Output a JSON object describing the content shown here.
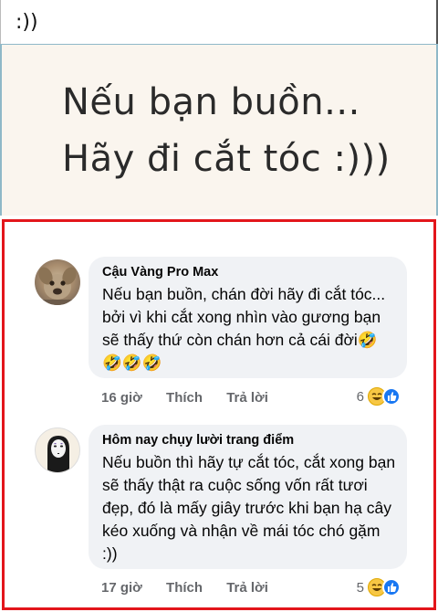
{
  "caption": ":))",
  "quote": {
    "line1": "Nếu bạn buồn...",
    "line2": "Hãy đi cắt tóc :)))"
  },
  "comments": [
    {
      "author": "Cậu Vàng Pro Max",
      "text": "Nếu bạn buồn, chán đời hãy đi cắt tóc... bởi vì khi cắt xong nhìn vào gương bạn sẽ thấy thứ còn chán hơn cả cái đời🤣🤣🤣🤣",
      "time": "16 giờ",
      "like_label": "Thích",
      "reply_label": "Trả lời",
      "reaction_count": "6",
      "avatar_icon": "dog-avatar"
    },
    {
      "author": "Hôm nay chụy lười trang điểm",
      "text": "Nếu buồn thì hãy tự cắt tóc, cắt xong bạn sẽ thấy thật ra cuộc sống vốn rất tươi đẹp, đó là mấy giây trước khi bạn hạ cây kéo xuống và nhận về mái tóc chó gặm :))",
      "time": "17 giờ",
      "like_label": "Thích",
      "reply_label": "Trả lời",
      "reaction_count": "5",
      "avatar_icon": "no-face-avatar"
    }
  ],
  "colors": {
    "highlight_border": "#e3161b",
    "bubble_bg": "#f0f2f5",
    "meta_text": "#65676b",
    "like_blue": "#1877f2",
    "haha_yellow": "#f7c744"
  }
}
